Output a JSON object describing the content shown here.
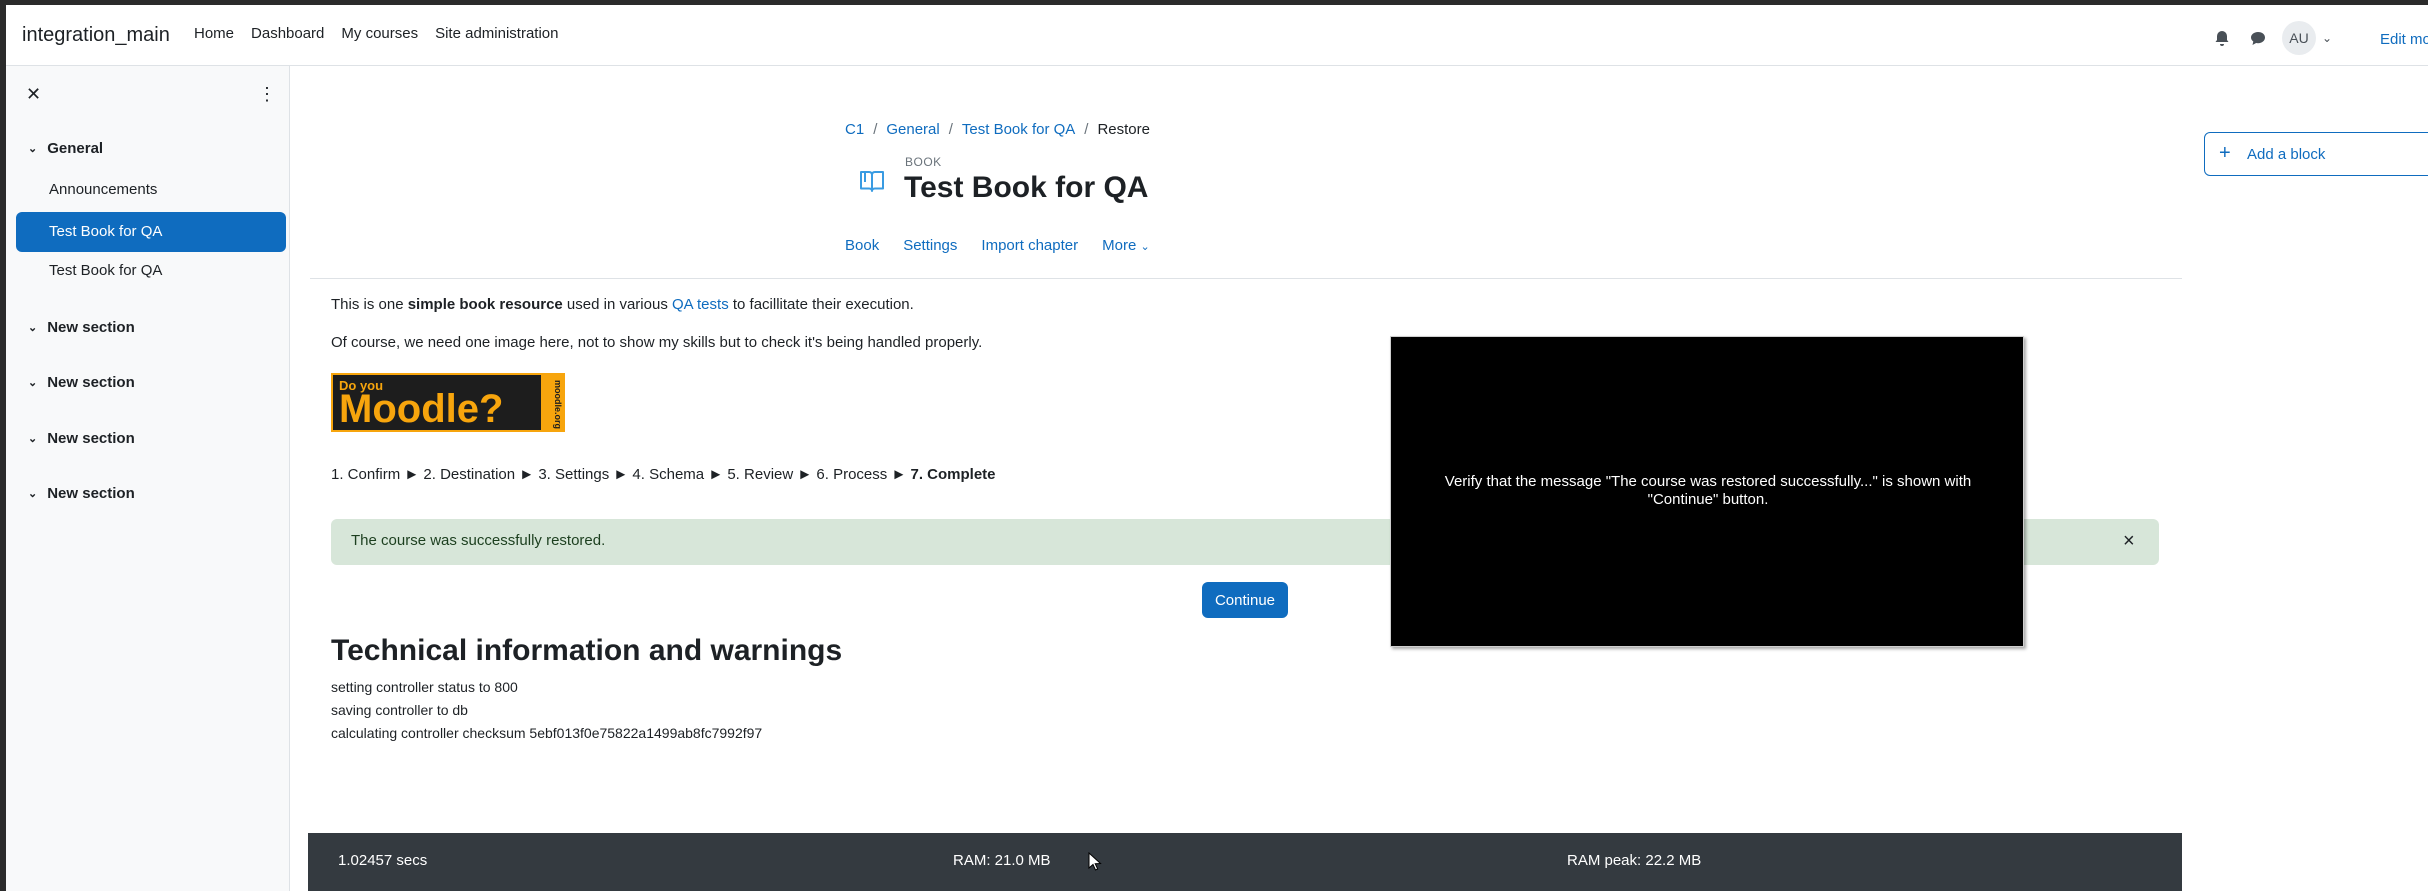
{
  "navbar": {
    "brand": "integration_main",
    "links": [
      "Home",
      "Dashboard",
      "My courses",
      "Site administration"
    ],
    "avatar_initials": "AU",
    "edit_mode_label": "Edit mod"
  },
  "drawer": {
    "sections": [
      {
        "label": "General",
        "activities": [
          "Announcements",
          "Test Book for QA",
          "Test Book for QA"
        ]
      },
      {
        "label": "New section"
      },
      {
        "label": "New section"
      },
      {
        "label": "New section"
      },
      {
        "label": "New section"
      }
    ]
  },
  "breadcrumb": {
    "items": [
      "C1",
      "General",
      "Test Book for QA"
    ],
    "current": "Restore"
  },
  "header": {
    "module_type": "BOOK",
    "title": "Test Book for QA"
  },
  "secondary_nav": [
    "Book",
    "Settings",
    "Import chapter",
    "More"
  ],
  "content": {
    "para1_before": "This is one ",
    "para1_bold": "simple book resource",
    "para1_middle": " used in various ",
    "para1_link": "QA tests",
    "para1_after": " to facillitate their execution.",
    "para2": "Of course, we need one image here, not to show my skills but to check it's being handled properly.",
    "image": {
      "line1": "Do you",
      "line2": "Moodle?",
      "side": "moodle.org"
    }
  },
  "steps": {
    "items": [
      "1. Confirm",
      "2. Destination",
      "3. Settings",
      "4. Schema",
      "5. Review",
      "6. Process"
    ],
    "current": "7. Complete",
    "separator": "►"
  },
  "alert": {
    "message": "The course was successfully restored.",
    "close": "×"
  },
  "continue_label": "Continue",
  "technical": {
    "title": "Technical information and warnings",
    "lines": [
      "setting controller status to 800",
      "saving controller to db",
      "calculating controller checksum 5ebf013f0e75822a1499ab8fc7992f97"
    ]
  },
  "block": {
    "add_label": "Add a block"
  },
  "overlay": {
    "message": "Verify that the message \"The course was restored successfully...\" is shown with \"Continue\" button."
  },
  "footer": {
    "time": "1.02457 secs",
    "ram": "RAM: 21.0 MB",
    "ram_peak": "RAM peak: 22.2 MB"
  },
  "colors": {
    "primary": "#0f6cbf",
    "alert_bg": "#d7e6d9",
    "footer_bg": "#343a40"
  }
}
